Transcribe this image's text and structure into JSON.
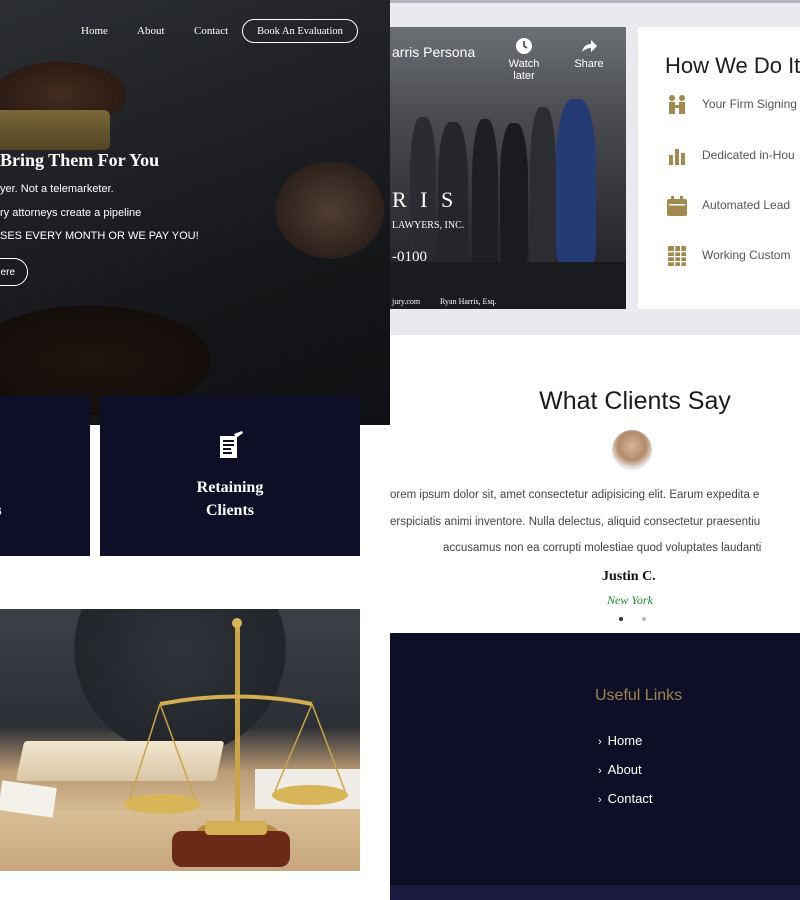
{
  "hero": {
    "nav": [
      "Home",
      "About",
      "Contact"
    ],
    "cta": "Book An Evaluation",
    "title": "Bring Them For You",
    "lines": [
      "yer. Not a telemarketer.",
      "ry attorneys create a pipeline",
      "SES EVERY MONTH OR WE PAY YOU!"
    ],
    "button": "ere"
  },
  "cards": {
    "left_lines": [
      "l",
      "ts"
    ],
    "right_lines": [
      "Retaining",
      "Clients"
    ],
    "right_icon": "document-edit-icon"
  },
  "video": {
    "title": "arris Persona",
    "watch_later": "Watch later",
    "share": "Share",
    "brand_big": "R I S",
    "brand_sub": "LAWYERS, INC.",
    "phone": "-0100",
    "site": "jury.com",
    "signer": "Ryan Harris, Esq."
  },
  "how": {
    "title": "How We Do It",
    "items": [
      {
        "icon": "people-icon",
        "text": "Your Firm Signing"
      },
      {
        "icon": "bar-chart-icon",
        "text": "Dedicated in-Hou"
      },
      {
        "icon": "calendar-icon",
        "text": "Automated Lead"
      },
      {
        "icon": "table-icon",
        "text": "Working Custom"
      }
    ],
    "accent": "#a08a4f"
  },
  "testimonial": {
    "title": "What Clients Say",
    "lines": [
      "orem ipsum dolor sit, amet consectetur adipisicing elit. Earum expedita e",
      "erspiciatis animi inventore. Nulla delectus, aliquid consectetur praesentiu",
      "accusamus non ea corrupti molestiae quod voluptates laudanti"
    ],
    "name": "Justin C.",
    "city": "New York"
  },
  "footer": {
    "title": "Useful Links",
    "links": [
      "Home",
      "About",
      "Contact"
    ],
    "title_color": "#9b8453",
    "bg": "#0f0e27"
  }
}
